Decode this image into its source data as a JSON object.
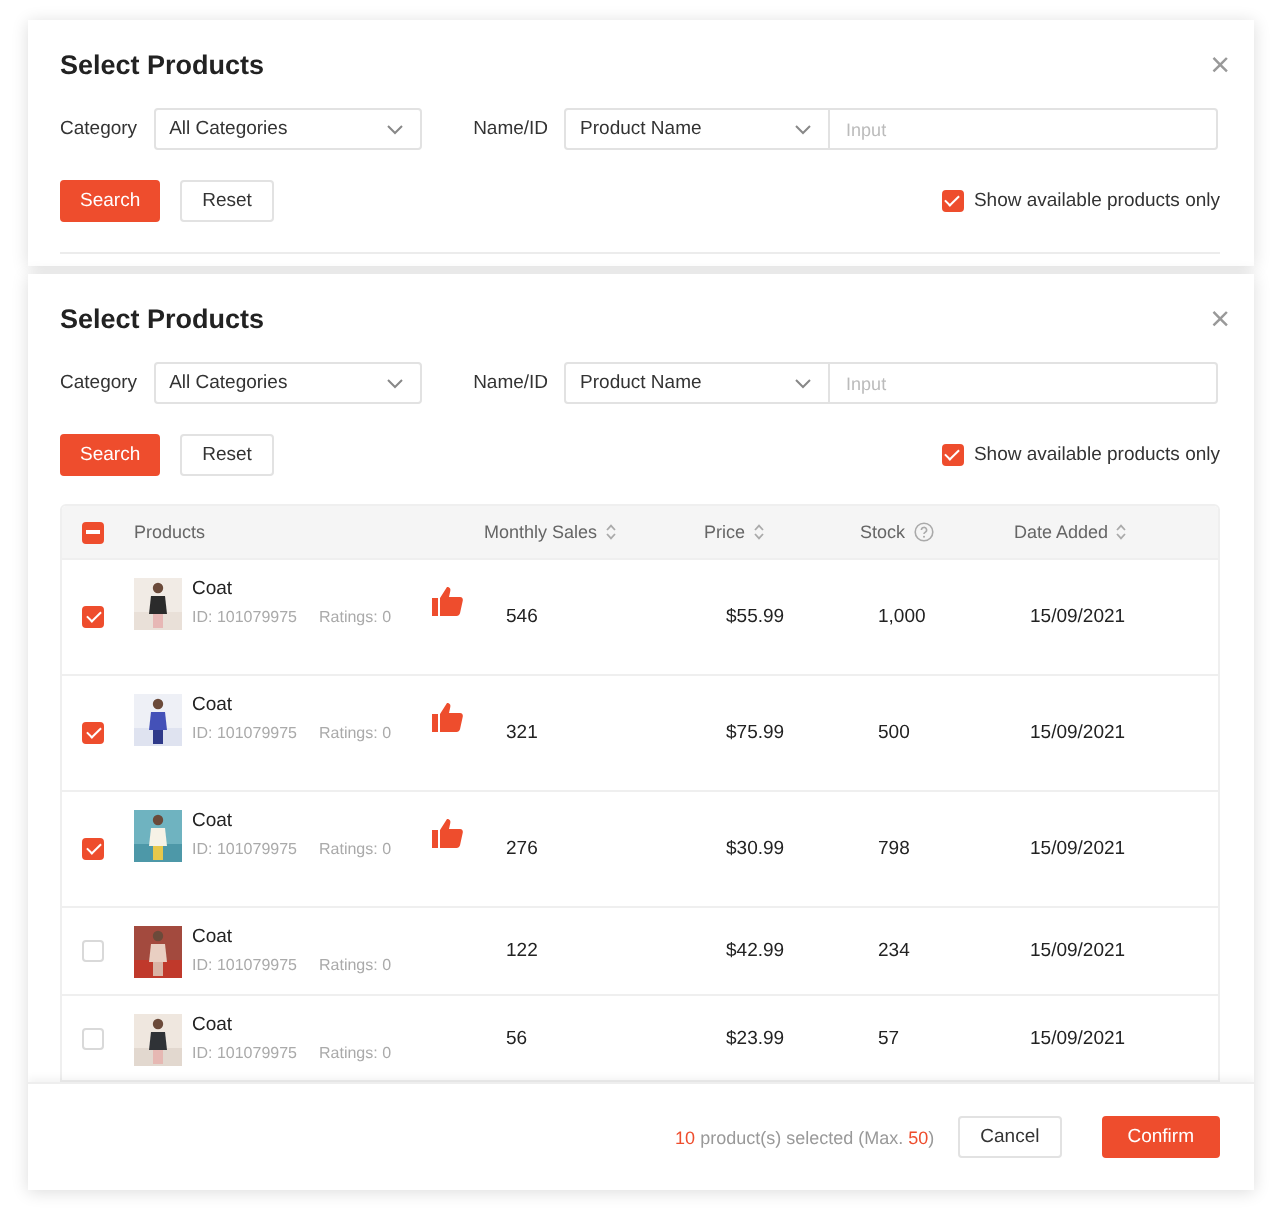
{
  "dialogs": [
    {
      "title": "Select Products",
      "close": "×",
      "category_label": "Category",
      "category_value": "All Categories",
      "name_label": "Name/ID",
      "name_mode": "Product Name",
      "name_placeholder": "Input",
      "search_button": "Search",
      "reset_button": "Reset",
      "available_only": {
        "label": "Show available products only",
        "checked": true
      }
    },
    {
      "title": "Select Products",
      "close": "×",
      "category_label": "Category",
      "category_value": "All Categories",
      "name_label": "Name/ID",
      "name_mode": "Product Name",
      "name_placeholder": "Input",
      "search_button": "Search",
      "reset_button": "Reset",
      "available_only": {
        "label": "Show available products only",
        "checked": true
      },
      "table": {
        "select_all": {
          "indeterminate": true
        },
        "columns": [
          {
            "label": "Products",
            "sortable": false,
            "help": false
          },
          {
            "label": "Monthly Sales",
            "sortable": true,
            "help": false
          },
          {
            "label": "Price",
            "sortable": true,
            "help": false
          },
          {
            "label": "Stock",
            "sortable": false,
            "help": true
          },
          {
            "label": "Date Added",
            "sortable": true,
            "help": false
          }
        ],
        "rows": [
          {
            "checked": true,
            "name": "Coat",
            "id": "ID: 101079975",
            "ratings": "Ratings: 0",
            "liked": true,
            "monthly_sales": "546",
            "price": "$55.99",
            "stock": "1,000",
            "date_added": "15/09/2021"
          },
          {
            "checked": true,
            "name": "Coat",
            "id": "ID: 101079975",
            "ratings": "Ratings: 0",
            "liked": true,
            "monthly_sales": "321",
            "price": "$75.99",
            "stock": "500",
            "date_added": "15/09/2021"
          },
          {
            "checked": true,
            "name": "Coat",
            "id": "ID: 101079975",
            "ratings": "Ratings: 0",
            "liked": true,
            "monthly_sales": "276",
            "price": "$30.99",
            "stock": "798",
            "date_added": "15/09/2021"
          },
          {
            "checked": false,
            "name": "Coat",
            "id": "ID: 101079975",
            "ratings": "Ratings: 0",
            "liked": false,
            "monthly_sales": "122",
            "price": "$42.99",
            "stock": "234",
            "date_added": "15/09/2021"
          },
          {
            "checked": false,
            "name": "Coat",
            "id": "ID: 101079975",
            "ratings": "Ratings: 0",
            "liked": false,
            "monthly_sales": "56",
            "price": "$23.99",
            "stock": "57",
            "date_added": "15/09/2021"
          }
        ]
      },
      "footer": {
        "selected_count": "10",
        "summary_text": "product(s) selected (Max.",
        "max": "50",
        "summary_end": ")",
        "cancel_button": "Cancel",
        "confirm_button": "Confirm"
      }
    }
  ]
}
